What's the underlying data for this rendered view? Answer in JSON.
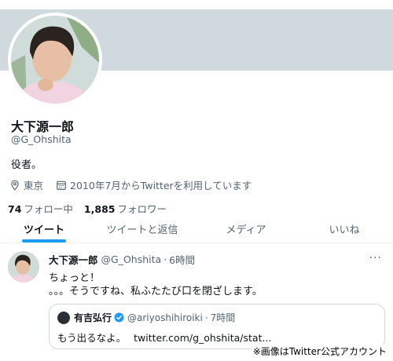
{
  "profile": {
    "name": "大下源一郎",
    "handle": "@G_Ohshita",
    "bio": "役者。",
    "location": "東京",
    "joined": "2010年7月からTwitterを利用しています",
    "following_count": "74",
    "following_label": "フォロー中",
    "followers_count": "1,885",
    "followers_label": "フォロワー"
  },
  "tabs": [
    {
      "label": "ツイート",
      "active": true
    },
    {
      "label": "ツイートと返信",
      "active": false
    },
    {
      "label": "メディア",
      "active": false
    },
    {
      "label": "いいね",
      "active": false
    }
  ],
  "tweet": {
    "name": "大下源一郎",
    "handle": "@G_Ohshita",
    "separator": "·",
    "time": "6時間",
    "line1": "ちょっと！",
    "line2": "。。。そうですね、私ふたたび口を閉ざします。",
    "quote": {
      "name": "有吉弘行",
      "handle": "@ariyoshihiroiki",
      "separator": "·",
      "time": "7時間",
      "text": "もう出るなよ。",
      "link": "twitter.com/g_ohshita/stat..."
    }
  },
  "caption": "※画像はTwitter公式アカウント",
  "icons": {
    "location": "location-pin-icon",
    "calendar": "calendar-icon",
    "verified": "verified-badge-icon",
    "more": "more-dots-icon"
  },
  "colors": {
    "accent": "#1d9bf0",
    "banner": "#cfd9de",
    "muted_text": "#536471"
  }
}
